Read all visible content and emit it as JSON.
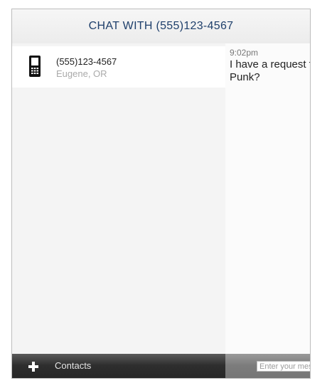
{
  "header": {
    "title": "CHAT WITH (555)123-4567"
  },
  "contacts": [
    {
      "number": "(555)123-4567",
      "location": "Eugene, OR",
      "icon": "mobile-phone-icon"
    }
  ],
  "conversation": {
    "messages": [
      {
        "time": "9:02pm",
        "text": "I have a request for Daft Punk?"
      }
    ]
  },
  "footer": {
    "add_icon": "plus-icon",
    "contacts_label": "Contacts",
    "message_placeholder": "Enter your message"
  },
  "colors": {
    "header_text": "#1e3f6b",
    "footer_dark": "#2e2e2e"
  }
}
